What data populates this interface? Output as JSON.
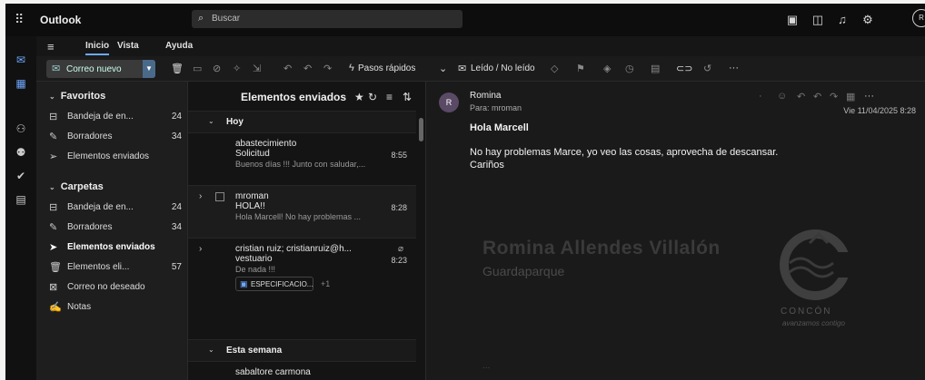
{
  "header": {
    "app_name": "Outlook",
    "search_placeholder": "Buscar",
    "avatar_initial": "R"
  },
  "menu": {
    "tabs": [
      "Inicio",
      "Vista",
      "Ayuda"
    ]
  },
  "toolbar": {
    "new_mail_label": "Correo nuevo",
    "quick_steps_label": "Pasos rápidos",
    "read_unread_label": "Leído / No leído"
  },
  "folders": {
    "favorites_label": "Favoritos",
    "favorites": [
      {
        "label": "Bandeja de en...",
        "count": "24",
        "icon": "inbox-icon"
      },
      {
        "label": "Borradores",
        "count": "34",
        "icon": "pencil-icon"
      },
      {
        "label": "Elementos enviados",
        "count": "",
        "icon": "send-icon"
      }
    ],
    "folders_label": "Carpetas",
    "items": [
      {
        "label": "Bandeja de en...",
        "count": "24",
        "icon": "inbox-icon"
      },
      {
        "label": "Borradores",
        "count": "34",
        "icon": "pencil-icon"
      },
      {
        "label": "Elementos enviados",
        "count": "",
        "icon": "send-icon",
        "selected": true
      },
      {
        "label": "Elementos eli...",
        "count": "57",
        "icon": "trash-icon"
      },
      {
        "label": "Correo no deseado",
        "count": "",
        "icon": "junk-icon"
      },
      {
        "label": "Notas",
        "count": "",
        "icon": "note-icon"
      }
    ]
  },
  "message_list": {
    "title": "Elementos enviados",
    "groups": {
      "today": "Hoy",
      "this_week": "Esta semana"
    },
    "messages": [
      {
        "from": "abastecimiento",
        "subject": "Solicitud",
        "time": "8:55",
        "preview": "Buenos días !!! Junto con saludar,..."
      },
      {
        "from": "mroman",
        "subject": "HOLA!!",
        "time": "8:28",
        "preview": "Hola Marcell! No hay problemas ..."
      },
      {
        "from": "cristian ruiz; cristianruiz@h...",
        "subject": "vestuario",
        "time": "8:23",
        "preview": "De nada !!!",
        "attachment": "ESPECIFICACIO...",
        "attachment_more": "+1"
      }
    ],
    "next_from": "sabaltore carmona"
  },
  "reading": {
    "avatar_initial": "R",
    "from": "Romina",
    "to": "Para: mroman",
    "date": "Vie 11/04/2025 8:28",
    "subject": "Hola Marcell",
    "body_line1": "No hay problemas Marce, yo veo las cosas, aprovecha de descansar.",
    "body_line2": "Cariños",
    "signature_name": "Romina Allendes Villalón",
    "signature_role": "Guardaparque",
    "logo_word": "CONCÓN",
    "logo_tagline": "avanzamos contigo",
    "bottom_dots": "..."
  }
}
